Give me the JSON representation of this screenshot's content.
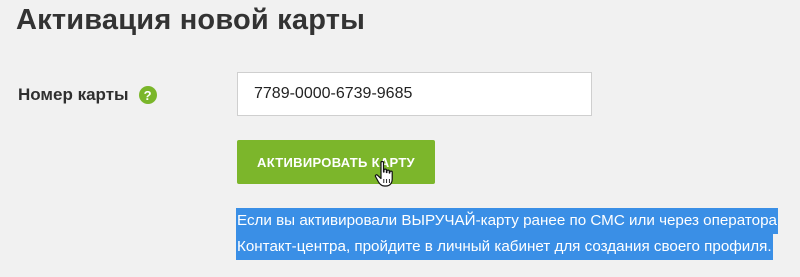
{
  "page": {
    "title": "Активация новой карты"
  },
  "form": {
    "card_label": "Номер карты",
    "help_symbol": "?",
    "card_number_value": "7789-0000-6739-9685",
    "activate_button_label": "АКТИВИРОВАТЬ КАРТУ"
  },
  "info": {
    "line1": "Если вы активировали ВЫРУЧАЙ-карту ранее по СМС или через оператора",
    "line2": "Контакт-центра, пройдите в личный кабинет для создания своего профиля."
  },
  "icons": {
    "help": "question-circle-icon",
    "cursor": "hand-pointer-icon"
  },
  "colors": {
    "accent_green": "#7cb62b",
    "selection_blue": "#3a8fe6",
    "background": "#f1f1f1"
  }
}
